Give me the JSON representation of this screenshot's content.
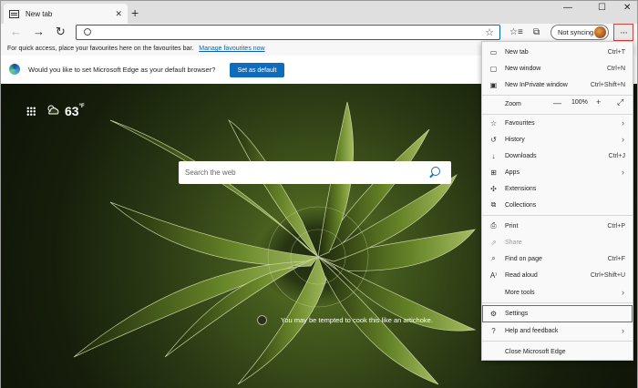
{
  "tab": {
    "title": "New tab",
    "close": "✕"
  },
  "newtab_button": "+",
  "window_controls": {
    "minimize": "—",
    "maximize": "☐",
    "close": "✕"
  },
  "toolbar": {
    "back": "←",
    "forward": "→",
    "refresh": "↻",
    "favorite_star": "☆",
    "sync_label": "Not syncing",
    "more": "···"
  },
  "favbar": {
    "text": "For quick access, place your favourites here on the favourites bar.",
    "link": "Manage favourites now"
  },
  "infobar": {
    "message": "Would you like to set Microsoft Edge as your default browser?",
    "button": "Set as default"
  },
  "ntp": {
    "temperature": "63",
    "temp_unit": "°F",
    "search_placeholder": "Search the web",
    "caption": "You may be tempted to cook this like an artichoke."
  },
  "menu": {
    "new_tab": {
      "label": "New tab",
      "shortcut": "Ctrl+T"
    },
    "new_window": {
      "label": "New window",
      "shortcut": "Ctrl+N"
    },
    "inprivate": {
      "label": "New InPrivate window",
      "shortcut": "Ctrl+Shift+N"
    },
    "zoom": {
      "label": "Zoom",
      "minus": "—",
      "value": "100%",
      "plus": "+",
      "fullscreen": "⤢"
    },
    "favourites": {
      "label": "Favourites",
      "chevron": "›"
    },
    "history": {
      "label": "History",
      "chevron": "›"
    },
    "downloads": {
      "label": "Downloads",
      "shortcut": "Ctrl+J"
    },
    "apps": {
      "label": "Apps",
      "chevron": "›"
    },
    "extensions": {
      "label": "Extensions"
    },
    "collections": {
      "label": "Collections"
    },
    "print": {
      "label": "Print",
      "shortcut": "Ctrl+P"
    },
    "share": {
      "label": "Share"
    },
    "find": {
      "label": "Find on page",
      "shortcut": "Ctrl+F"
    },
    "read_aloud": {
      "label": "Read aloud",
      "shortcut": "Ctrl+Shift+U"
    },
    "more_tools": {
      "label": "More tools",
      "chevron": "›"
    },
    "settings": {
      "label": "Settings"
    },
    "help": {
      "label": "Help and feedback",
      "chevron": "›"
    },
    "close_edge": {
      "label": "Close Microsoft Edge"
    }
  },
  "colors": {
    "accent": "#0f6cbd",
    "highlight_border": "#d0463c",
    "menu_bg": "#f9f9f9"
  }
}
